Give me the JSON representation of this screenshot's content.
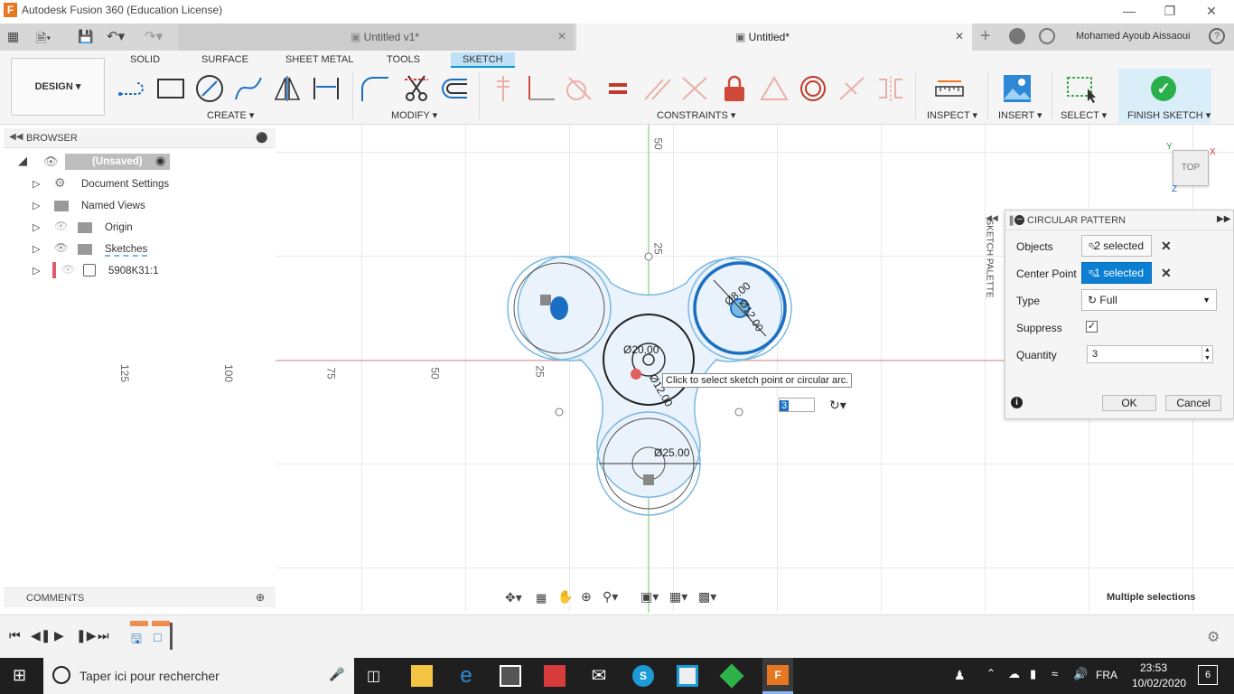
{
  "window": {
    "title": "Autodesk Fusion 360 (Education License)"
  },
  "tabs": [
    {
      "label": "Untitled v1*"
    },
    {
      "label": "Untitled*"
    }
  ],
  "account": {
    "user": "Mohamed Ayoub Aissaoui"
  },
  "ribbon": {
    "workspace": "DESIGN",
    "tabs": [
      "SOLID",
      "SURFACE",
      "SHEET METAL",
      "TOOLS",
      "SKETCH"
    ],
    "groups": {
      "create": "CREATE",
      "modify": "MODIFY",
      "constraints": "CONSTRAINTS",
      "inspect": "INSPECT",
      "insert": "INSERT",
      "select": "SELECT",
      "finish": "FINISH SKETCH"
    }
  },
  "browser": {
    "title": "BROWSER",
    "items": [
      "(Unsaved)",
      "Document Settings",
      "Named Views",
      "Origin",
      "Sketches",
      "5908K31:1"
    ]
  },
  "comments": {
    "title": "COMMENTS"
  },
  "sketch_palette": "SKETCH PALETTE",
  "viewcube": {
    "label": "TOP",
    "axis": "Z",
    "x": "X",
    "y": "Y"
  },
  "canvas": {
    "axis_labels": [
      "125",
      "100",
      "75",
      "50",
      "25",
      "50",
      "25"
    ],
    "dimensions": [
      "Ø25.00",
      "Ø12.00",
      "Ø8.00",
      "Ø20.00",
      "Ø12.00"
    ],
    "tooltip": "Click to select sketch point or circular arc.",
    "inline_quantity": "3"
  },
  "dialog": {
    "title": "CIRCULAR PATTERN",
    "objects_label": "Objects",
    "objects_value": "2 selected",
    "center_label": "Center Point",
    "center_value": "1 selected",
    "type_label": "Type",
    "type_value": "Full",
    "suppress_label": "Suppress",
    "quantity_label": "Quantity",
    "quantity_value": "3",
    "ok": "OK",
    "cancel": "Cancel"
  },
  "status": {
    "multiple": "Multiple selections"
  },
  "taskbar": {
    "search_placeholder": "Taper ici pour rechercher",
    "lang": "FRA",
    "time": "23:53",
    "date": "10/02/2020",
    "notifications": "6"
  }
}
